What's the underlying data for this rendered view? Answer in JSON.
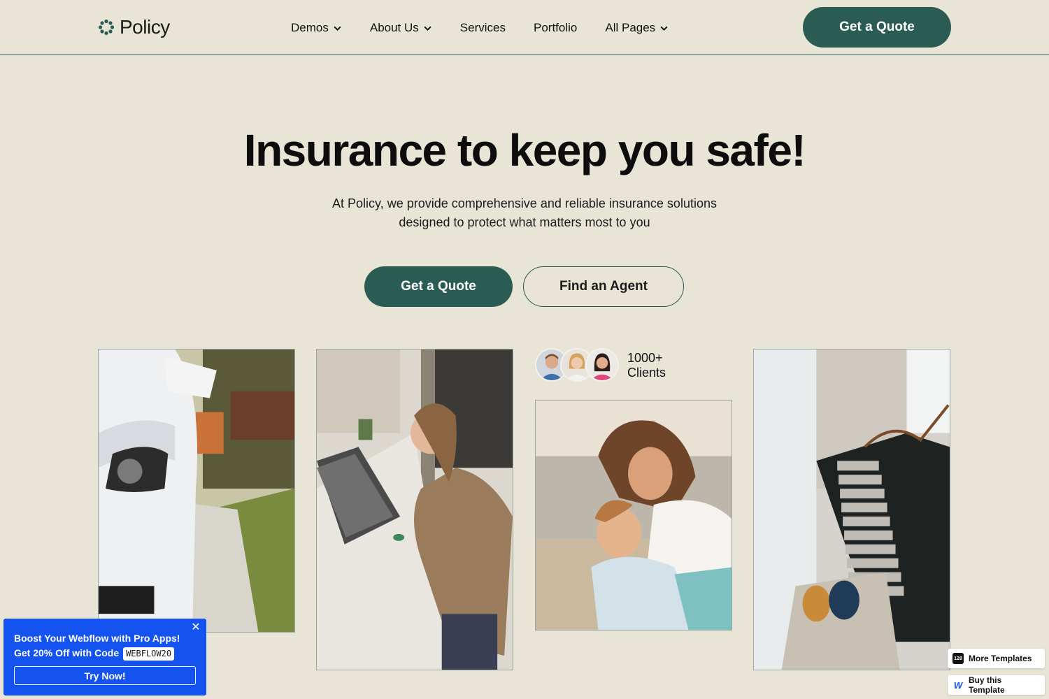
{
  "brand": {
    "name": "Policy",
    "accent": "#2b5c54",
    "background": "#e8e5d7"
  },
  "nav": {
    "items": [
      {
        "label": "Demos",
        "dropdown": true
      },
      {
        "label": "About Us",
        "dropdown": true
      },
      {
        "label": "Services",
        "dropdown": false
      },
      {
        "label": "Portfolio",
        "dropdown": false
      },
      {
        "label": "All Pages",
        "dropdown": true
      }
    ],
    "cta": "Get a Quote"
  },
  "hero": {
    "title": "Insurance to keep you safe!",
    "subtitle_line1": "At Policy, we provide comprehensive and reliable insurance solutions",
    "subtitle_line2": "designed to protect what matters most to you",
    "primary_button": "Get a Quote",
    "secondary_button": "Find an Agent"
  },
  "clients": {
    "count": "1000+",
    "label": "Clients"
  },
  "photos": [
    {
      "name": "car-headlight-photo"
    },
    {
      "name": "woman-at-desk-photo"
    },
    {
      "name": "mother-and-child-photo"
    },
    {
      "name": "staircase-interior-photo"
    }
  ],
  "promo": {
    "line1": "Boost Your Webflow with Pro Apps!",
    "line2": "Get 20% Off with Code",
    "code": "WEBFLOW20",
    "button": "Try Now!",
    "color": "#1453f0"
  },
  "badges": {
    "more_templates": "More Templates",
    "more_templates_icon": "128",
    "buy_template": "Buy this Template",
    "buy_template_icon": "W"
  }
}
